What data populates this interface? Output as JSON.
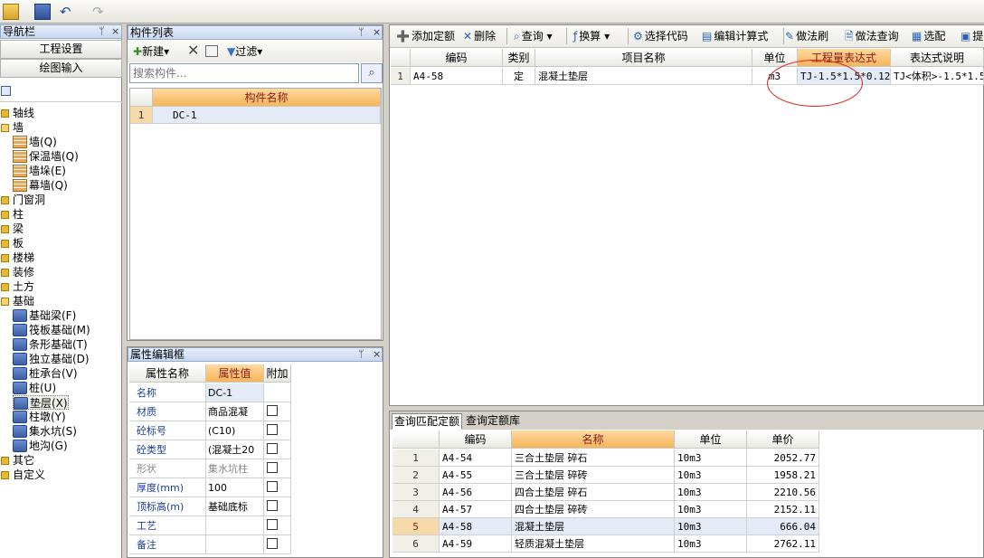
{
  "toolbar_top": {
    "icons": [
      "open-folder-icon",
      "save-icon",
      "undo-icon",
      "redo-icon"
    ]
  },
  "nav": {
    "title": "导航栏",
    "pin": "ᛘ",
    "close": "×",
    "btn1": "工程设置",
    "btn2": "绘图输入",
    "tree": [
      {
        "label": "轴线",
        "level": 0,
        "type": "folder"
      },
      {
        "label": "墙",
        "level": 0,
        "type": "folder-open"
      },
      {
        "label": "墙(Q)",
        "level": 1,
        "type": "wall"
      },
      {
        "label": "保温墙(Q)",
        "level": 1,
        "type": "wall"
      },
      {
        "label": "墙垛(E)",
        "level": 1,
        "type": "wall"
      },
      {
        "label": "幕墙(Q)",
        "level": 1,
        "type": "wall"
      },
      {
        "label": "门窗洞",
        "level": 0,
        "type": "folder"
      },
      {
        "label": "柱",
        "level": 0,
        "type": "folder"
      },
      {
        "label": "梁",
        "level": 0,
        "type": "folder"
      },
      {
        "label": "板",
        "level": 0,
        "type": "folder"
      },
      {
        "label": "楼梯",
        "level": 0,
        "type": "folder"
      },
      {
        "label": "装修",
        "level": 0,
        "type": "folder"
      },
      {
        "label": "土方",
        "level": 0,
        "type": "folder"
      },
      {
        "label": "基础",
        "level": 0,
        "type": "folder-open"
      },
      {
        "label": "基础梁(F)",
        "level": 1,
        "type": "base"
      },
      {
        "label": "筏板基础(M)",
        "level": 1,
        "type": "base"
      },
      {
        "label": "条形基础(T)",
        "level": 1,
        "type": "base"
      },
      {
        "label": "独立基础(D)",
        "level": 1,
        "type": "base"
      },
      {
        "label": "桩承台(V)",
        "level": 1,
        "type": "base"
      },
      {
        "label": "桩(U)",
        "level": 1,
        "type": "base"
      },
      {
        "label": "垫层(X)",
        "level": 1,
        "type": "base",
        "selected": true
      },
      {
        "label": "柱墩(Y)",
        "level": 1,
        "type": "base"
      },
      {
        "label": "集水坑(S)",
        "level": 1,
        "type": "base"
      },
      {
        "label": "地沟(G)",
        "level": 1,
        "type": "base"
      },
      {
        "label": "其它",
        "level": 0,
        "type": "folder"
      },
      {
        "label": "自定义",
        "level": 0,
        "type": "folder"
      }
    ]
  },
  "component_list": {
    "title": "构件列表",
    "new": "新建",
    "filter": "过滤",
    "search_placeholder": "搜索构件...",
    "col": "构件名称",
    "rows": [
      {
        "no": "1",
        "name": "DC-1"
      }
    ]
  },
  "property": {
    "title": "属性编辑框",
    "col_name": "属性名称",
    "col_value": "属性值",
    "col_add": "附加",
    "rows": [
      {
        "name": "名称",
        "value": "DC-1",
        "cb": false,
        "grey": false
      },
      {
        "name": "材质",
        "value": "商品混凝",
        "cb": true,
        "grey": false
      },
      {
        "name": "砼标号",
        "value": "(C10)",
        "cb": true,
        "grey": false
      },
      {
        "name": "砼类型",
        "value": "(混凝土20",
        "cb": true,
        "grey": false
      },
      {
        "name": "形状",
        "value": "集水坑柱",
        "cb": true,
        "grey": true
      },
      {
        "name": "厚度(mm)",
        "value": "100",
        "cb": true,
        "grey": false
      },
      {
        "name": "顶标高(m)",
        "value": "基础底标",
        "cb": true,
        "grey": false
      },
      {
        "name": "工艺",
        "value": "",
        "cb": true,
        "grey": false
      },
      {
        "name": "备注",
        "value": "",
        "cb": true,
        "grey": false
      }
    ]
  },
  "quota_toolbar": {
    "add": "添加定额",
    "delete": "删除",
    "query": "查询",
    "convert": "换算",
    "select_code": "选择代码",
    "edit_formula": "编辑计算式",
    "brush": "做法刷",
    "query_method": "做法查询",
    "match": "选配",
    "extract": "提"
  },
  "quota_table": {
    "headers": [
      "编码",
      "类别",
      "项目名称",
      "单位",
      "工程量表达式",
      "表达式说明"
    ],
    "rows": [
      {
        "no": "1",
        "code": "A4-58",
        "type": "定",
        "name": "混凝土垫层",
        "unit": "m3",
        "expr": "TJ-1.5*1.5*0.12",
        "desc": "TJ<体积>-1.5*1.5*"
      }
    ]
  },
  "bottom": {
    "tab1": "查询匹配定额",
    "tab2": "查询定额库",
    "headers": [
      "编码",
      "名称",
      "单位",
      "单价"
    ],
    "rows": [
      {
        "no": "1",
        "code": "A4-54",
        "name": "三合土垫层 碎石",
        "unit": "10m3",
        "price": "2052.77"
      },
      {
        "no": "2",
        "code": "A4-55",
        "name": "三合土垫层 碎砖",
        "unit": "10m3",
        "price": "1958.21"
      },
      {
        "no": "3",
        "code": "A4-56",
        "name": "四合土垫层 碎石",
        "unit": "10m3",
        "price": "2210.56"
      },
      {
        "no": "4",
        "code": "A4-57",
        "name": "四合土垫层 碎砖",
        "unit": "10m3",
        "price": "2152.11"
      },
      {
        "no": "5",
        "code": "A4-58",
        "name": "混凝土垫层",
        "unit": "10m3",
        "price": "666.04",
        "selected": true
      },
      {
        "no": "6",
        "code": "A4-59",
        "name": "轻质混凝土垫层",
        "unit": "10m3",
        "price": "2762.11"
      }
    ]
  }
}
